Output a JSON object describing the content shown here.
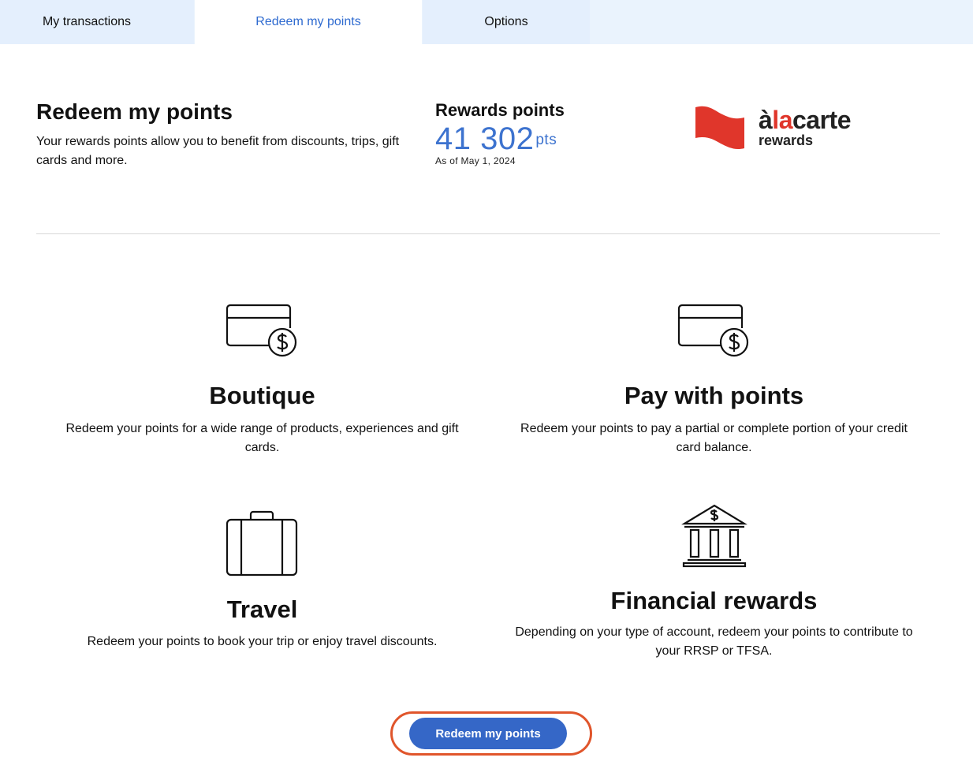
{
  "tabs": [
    {
      "label": "My transactions",
      "active": false
    },
    {
      "label": "Redeem my points",
      "active": true
    },
    {
      "label": "Options",
      "active": false
    }
  ],
  "header": {
    "title": "Redeem my points",
    "intro": "Your rewards points allow you to benefit from discounts, trips, gift cards and more."
  },
  "rewards": {
    "label": "Rewards points",
    "value": "41 302",
    "unit": "pts",
    "as_of": "As of May 1, 2024"
  },
  "logo": {
    "word_prefix": "à",
    "word_red": "la",
    "word_suffix": "carte",
    "sub": "rewards",
    "flag_color": "#e0362b"
  },
  "options": [
    {
      "icon": "credit-card-dollar-icon",
      "title": "Boutique",
      "description": "Redeem your points for a wide range of products, experiences and gift cards."
    },
    {
      "icon": "credit-card-dollar-icon",
      "title": "Pay with points",
      "description": "Redeem your points to pay a partial or complete portion of your credit card balance."
    },
    {
      "icon": "suitcase-icon",
      "title": "Travel",
      "description": "Redeem your points to book your trip or enjoy travel discounts."
    },
    {
      "icon": "bank-icon",
      "title": "Financial rewards",
      "description": "Depending on your type of account, redeem your points to contribute to your RRSP or TFSA."
    }
  ],
  "cta": {
    "label": "Redeem my points"
  },
  "colors": {
    "accent": "#3567c7",
    "points_blue": "#3d73cf",
    "highlight_ring": "#e0552b",
    "tab_bg": "#e4effd"
  }
}
